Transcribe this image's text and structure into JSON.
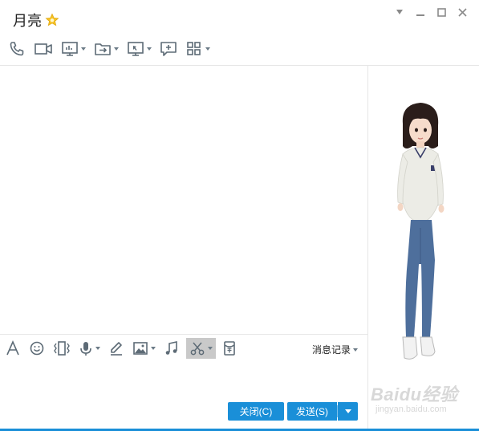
{
  "window": {
    "contact_name": "月亮",
    "favorite_icon": "star-icon",
    "controls": [
      "chevron-down-icon",
      "minimize-icon",
      "maximize-icon",
      "close-icon"
    ]
  },
  "top_toolbar": {
    "items": [
      {
        "icon": "phone-icon",
        "has_dropdown": false
      },
      {
        "icon": "video-camera-icon",
        "has_dropdown": false
      },
      {
        "icon": "screen-share-icon",
        "has_dropdown": true
      },
      {
        "icon": "file-transfer-icon",
        "has_dropdown": true
      },
      {
        "icon": "remote-desktop-icon",
        "has_dropdown": true
      },
      {
        "icon": "add-chat-icon",
        "has_dropdown": false
      },
      {
        "icon": "apps-grid-icon",
        "has_dropdown": true
      }
    ]
  },
  "input_toolbar": {
    "items": [
      {
        "icon": "font-icon",
        "has_dropdown": false
      },
      {
        "icon": "emoji-icon",
        "has_dropdown": false
      },
      {
        "icon": "shake-icon",
        "has_dropdown": false
      },
      {
        "icon": "microphone-icon",
        "has_dropdown": true
      },
      {
        "icon": "handwriting-icon",
        "has_dropdown": false
      },
      {
        "icon": "image-icon",
        "has_dropdown": true
      },
      {
        "icon": "music-icon",
        "has_dropdown": false
      },
      {
        "icon": "scissors-icon",
        "has_dropdown": true,
        "active": true
      },
      {
        "icon": "red-packet-icon",
        "has_dropdown": false
      }
    ],
    "history_label": "消息记录"
  },
  "buttons": {
    "close_label": "关闭(C)",
    "send_label": "发送(S)"
  },
  "watermark": {
    "main": "Baidu经验",
    "sub": "jingyan.baidu.com"
  },
  "colors": {
    "accent": "#1a8fd8",
    "icon": "#5d6b76",
    "star": "#f7c325"
  }
}
